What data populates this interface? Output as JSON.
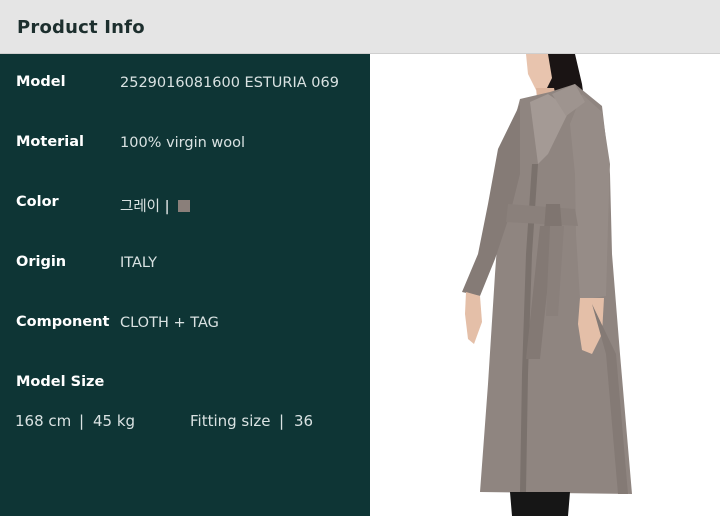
{
  "header": {
    "title": "Product Info"
  },
  "info": {
    "model_label": "Model",
    "model_value": "2529016081600 ESTURIA 069",
    "material_label": "Moterial",
    "material_value": "100% virgin wool",
    "color_label": "Color",
    "color_value": "그레이",
    "color_separator": "|",
    "color_swatch": "#8a7f7a",
    "origin_label": "Origin",
    "origin_value": "ITALY",
    "component_label": "Component",
    "component_value": "CLOTH + TAG",
    "model_size_label": "Model Size",
    "height": "168 cm",
    "sep1": "|",
    "weight": "45 kg",
    "fitting_label": "Fitting size",
    "sep2": "|",
    "fitting_value": "36"
  },
  "colors": {
    "panel": "#0e3535",
    "header_bg": "#e5e5e5",
    "coat": "#8f8580"
  }
}
